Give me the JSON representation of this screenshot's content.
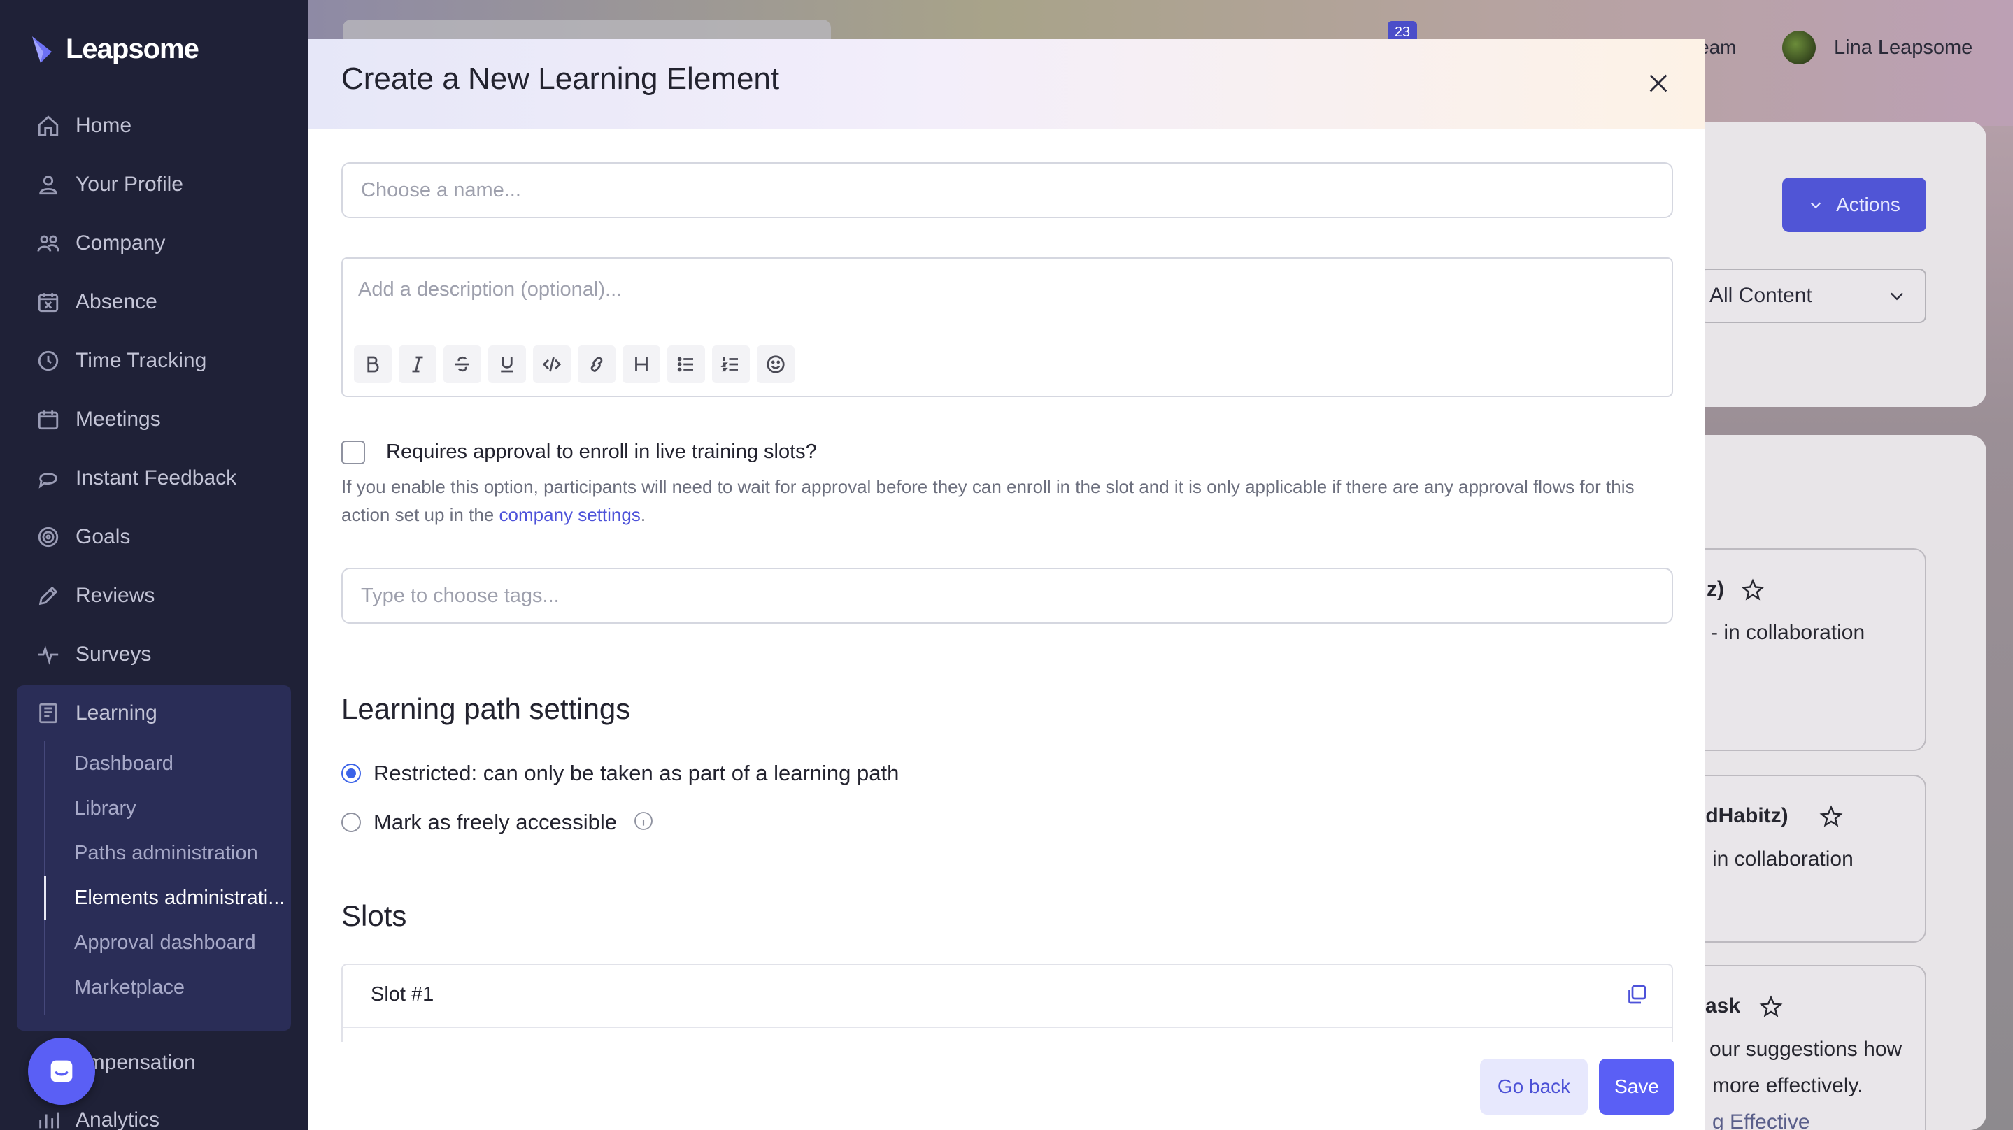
{
  "app": {
    "name": "Leapsome"
  },
  "sidebar": {
    "items": [
      {
        "label": "Home",
        "icon": "home-icon"
      },
      {
        "label": "Your Profile",
        "icon": "user-icon"
      },
      {
        "label": "Company",
        "icon": "people-icon"
      },
      {
        "label": "Absence",
        "icon": "calendar-x-icon"
      },
      {
        "label": "Time Tracking",
        "icon": "clock-icon"
      },
      {
        "label": "Meetings",
        "icon": "calendar-icon"
      },
      {
        "label": "Instant Feedback",
        "icon": "chat-icon"
      },
      {
        "label": "Goals",
        "icon": "target-icon"
      },
      {
        "label": "Reviews",
        "icon": "pencil-icon"
      },
      {
        "label": "Surveys",
        "icon": "pulse-icon"
      },
      {
        "label": "Learning",
        "icon": "book-icon"
      },
      {
        "label": "ompensation",
        "icon": "money-icon"
      },
      {
        "label": "Analytics",
        "icon": "chart-icon"
      }
    ],
    "learning_sub": [
      {
        "label": "Dashboard"
      },
      {
        "label": "Library"
      },
      {
        "label": "Paths administration"
      },
      {
        "label": "Elements administrati...",
        "active": true
      },
      {
        "label": "Approval dashboard"
      },
      {
        "label": "Marketplace"
      }
    ]
  },
  "header": {
    "notification_count": "23",
    "team_label": "eam",
    "user_name": "Lina Leapsome"
  },
  "background": {
    "actions_label": "Actions",
    "filter_value": "All Content",
    "items": [
      {
        "title": "z)",
        "subtitle": "- in collaboration"
      },
      {
        "title": "odHabitz)",
        "subtitle": "in collaboration"
      },
      {
        "title": "ask",
        "subtitle": "our suggestions how",
        "subtitle2": "more effectively.",
        "subtitle3": "g Effective"
      }
    ]
  },
  "modal": {
    "title": "Create a New Learning Element",
    "name_placeholder": "Choose a name...",
    "description_placeholder": "Add a description (optional)...",
    "toolbar": [
      "bold-icon",
      "italic-icon",
      "strikethrough-icon",
      "underline-icon",
      "code-icon",
      "link-icon",
      "heading-icon",
      "bullet-list-icon",
      "numbered-list-icon",
      "emoji-icon"
    ],
    "approval_label": "Requires approval to enroll in live training slots?",
    "approval_help_prefix": "If you enable this option, participants will need to wait for approval before they can enroll in the slot and it is only applicable if there are any approval flows for this action set up in the ",
    "approval_help_link": "company settings",
    "approval_help_suffix": ".",
    "tags_placeholder": "Type to choose tags...",
    "path_settings_title": "Learning path settings",
    "radio_restricted": "Restricted: can only be taken as part of a learning path",
    "radio_free": "Mark as freely accessible",
    "slots_title": "Slots",
    "slot_name": "Slot #1",
    "go_back_label": "Go back",
    "save_label": "Save"
  },
  "colors": {
    "sidebar_bg": "#1f2137",
    "accent": "#5a5ff5",
    "link": "#4d52d9",
    "radio_checked": "#3b63e8"
  }
}
